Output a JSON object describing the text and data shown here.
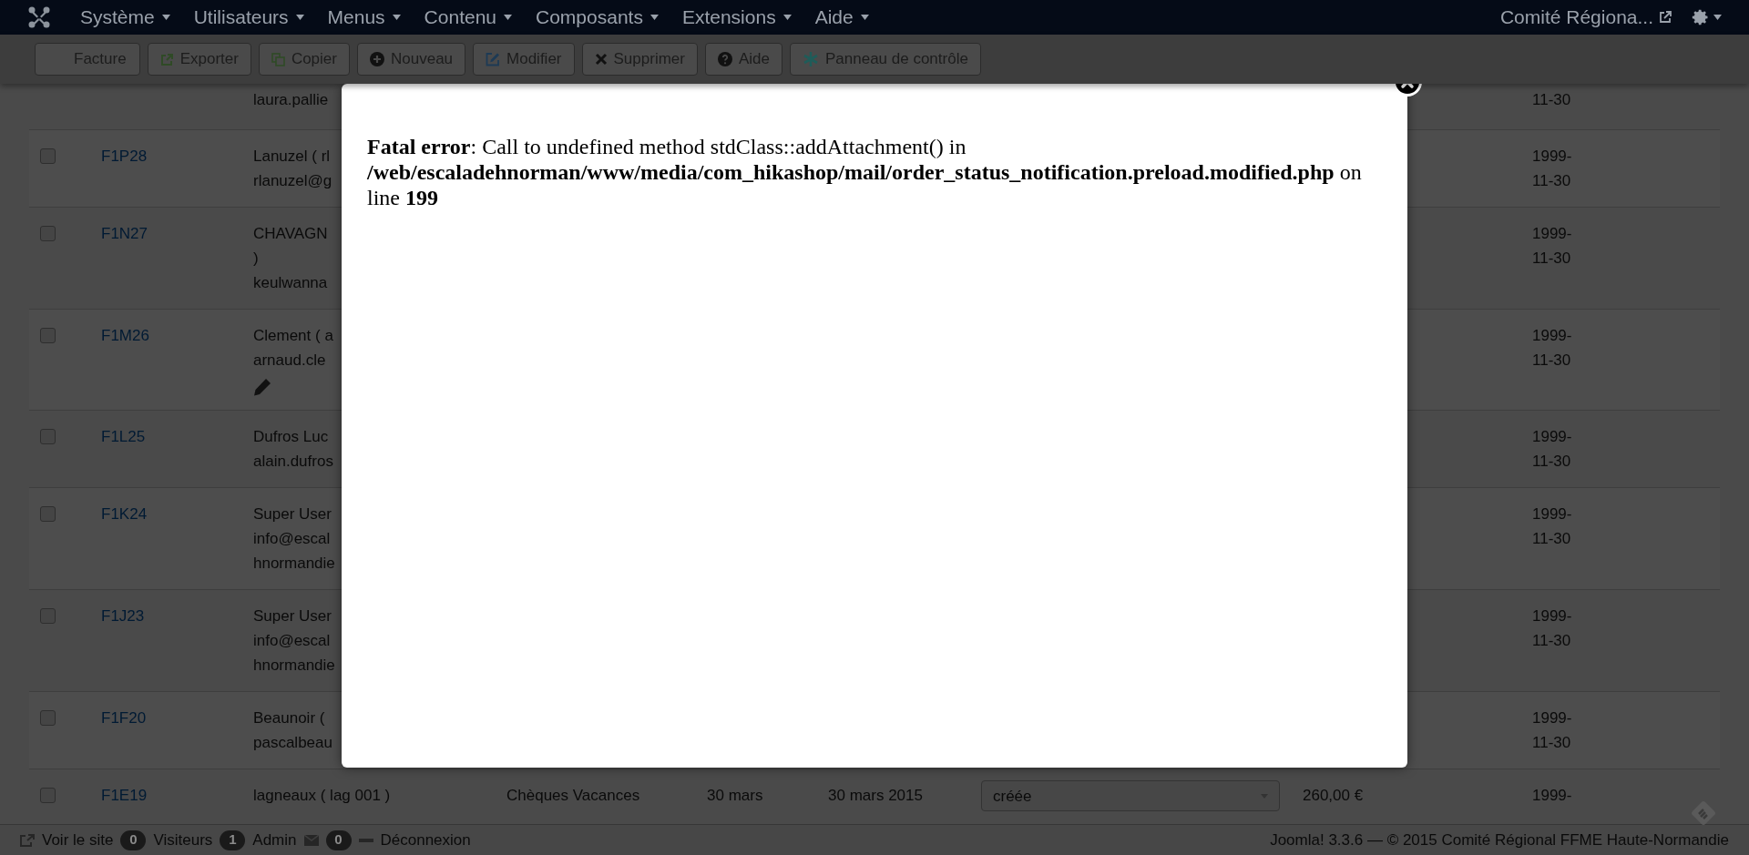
{
  "navbar": {
    "menus": [
      {
        "label": "Système"
      },
      {
        "label": "Utilisateurs"
      },
      {
        "label": "Menus"
      },
      {
        "label": "Contenu"
      },
      {
        "label": "Composants"
      },
      {
        "label": "Extensions"
      },
      {
        "label": "Aide"
      }
    ],
    "site_link": "Comité Régiona..."
  },
  "toolbar": {
    "buttons": [
      {
        "label": "Facture",
        "kind": "plain"
      },
      {
        "label": "Exporter",
        "kind": "export"
      },
      {
        "label": "Copier",
        "kind": "copy"
      },
      {
        "label": "Nouveau",
        "kind": "new"
      },
      {
        "label": "Modifier",
        "kind": "edit"
      },
      {
        "label": "Supprimer",
        "kind": "delete"
      },
      {
        "label": "Aide",
        "kind": "help"
      },
      {
        "label": "Panneau de contrôle",
        "kind": "dashboard"
      }
    ]
  },
  "table": {
    "rows": [
      {
        "kind": "cut_top",
        "customer": [
          "laura.pallie"
        ],
        "date": [
          "11-30"
        ]
      },
      {
        "kind": "row",
        "checked": false,
        "number": "F1P28",
        "customer": [
          "Lanuzel ( rl",
          "rlanuzel@g"
        ],
        "edit_icon": false,
        "date": [
          "1999-",
          "11-30"
        ]
      },
      {
        "kind": "row",
        "checked": false,
        "number": "F1N27",
        "customer": [
          "CHAVAGN",
          ")",
          "keulwanna"
        ],
        "edit_icon": false,
        "date": [
          "1999-",
          "11-30"
        ]
      },
      {
        "kind": "row",
        "checked": false,
        "number": "F1M26",
        "customer": [
          "Clement ( a",
          "arnaud.cle"
        ],
        "edit_icon": true,
        "date": [
          "1999-",
          "11-30"
        ]
      },
      {
        "kind": "row",
        "checked": false,
        "number": "F1L25",
        "customer": [
          "Dufros Luc",
          "alain.dufros"
        ],
        "edit_icon": false,
        "date": [
          "1999-",
          "11-30"
        ]
      },
      {
        "kind": "row",
        "checked": false,
        "number": "F1K24",
        "customer": [
          "Super User",
          "info@escal",
          "hnormandie"
        ],
        "edit_icon": false,
        "date": [
          "1999-",
          "11-30"
        ]
      },
      {
        "kind": "row",
        "checked": false,
        "number": "F1J23",
        "customer": [
          "Super User",
          "info@escal",
          "hnormandie"
        ],
        "edit_icon": false,
        "date": [
          "1999-",
          "11-30"
        ]
      },
      {
        "kind": "row",
        "checked": false,
        "number": "F1F20",
        "customer": [
          "Beaunoir (",
          "pascalbeau"
        ],
        "edit_icon": false,
        "date": [
          "1999-",
          "11-30"
        ]
      },
      {
        "kind": "row",
        "checked": false,
        "number": "F1E19",
        "customer": [
          "lagneaux ( lag 001 )"
        ],
        "edit_icon": false,
        "payment": "Chèques Vacances",
        "order_date": "30 mars",
        "invoice_date": "30 mars 2015",
        "status": "créée",
        "amount": "260,00 €",
        "date": [
          "1999-"
        ]
      }
    ]
  },
  "modal": {
    "message": "**Fatal error**: Call to undefined method stdClass::addAttachment() in **/web/escaladehnorman/www/media/com_hikashop/mail/order_status_notification.preload.modified.php** on line **199**"
  },
  "status_bar": {
    "items": [
      {
        "kind": "link",
        "label": "Voir le site"
      },
      {
        "kind": "count",
        "count": "0",
        "label": "Visiteurs"
      },
      {
        "kind": "count",
        "count": "1",
        "label": "Admin"
      },
      {
        "kind": "mail",
        "count": "0"
      },
      {
        "kind": "logout",
        "label": "Déconnexion"
      }
    ],
    "copyright": "Joomla! 3.3.6 — © 2015 Comité Régional FFME Haute-Normandie"
  }
}
